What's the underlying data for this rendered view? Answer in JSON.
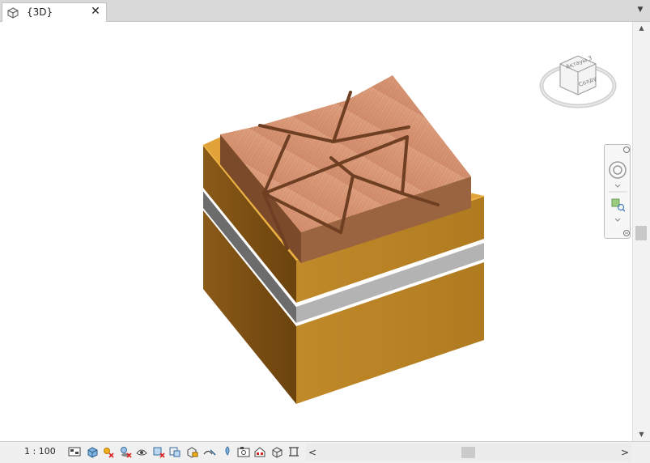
{
  "tab": {
    "label": "{3D}",
    "close_label": "✕"
  },
  "tab_menu": "▼",
  "viewcube": {
    "left_face": "Ақтауы З",
    "right_face": "Солдү"
  },
  "view_control": {
    "scale": "1 : 100"
  },
  "scrollbar": {
    "left_arrow": "<",
    "right_arrow": ">",
    "up_arrow": "▲",
    "down_arrow": "▼"
  },
  "colors": {
    "tab_bg": "#d9d9d9",
    "wood_top": "#d9987a",
    "band": "#c8962d",
    "stripe": "#a5a5a5"
  },
  "icons": [
    "3d-view-icon",
    "close-icon",
    "visual-style-icon",
    "sun-path-icon",
    "shadows-icon",
    "crop-view-icon",
    "render-icon",
    "view-cube-icon",
    "full-navigation-wheel-icon",
    "zoom-region-icon"
  ]
}
